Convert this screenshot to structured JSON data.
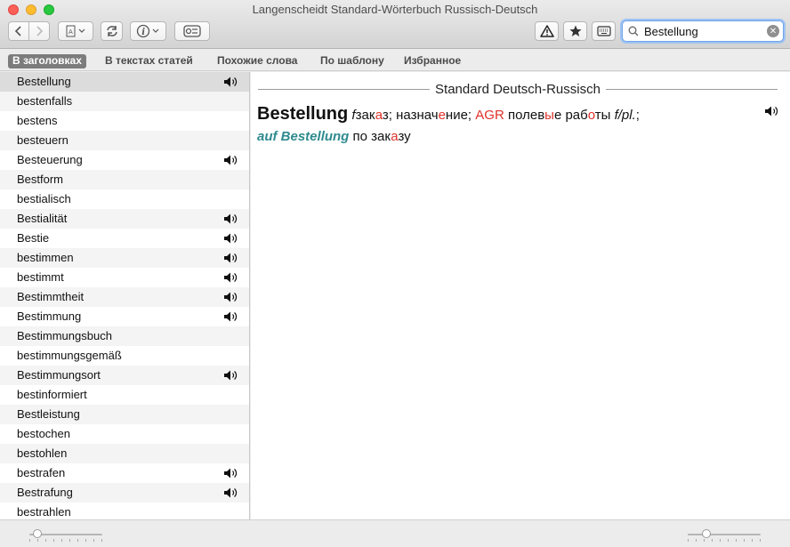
{
  "window": {
    "title": "Langenscheidt Standard-Wörterbuch Russisch-Deutsch"
  },
  "toolbar": {
    "back_icon": "chevron-left-icon",
    "forward_icon": "chevron-right-icon",
    "dictionary_menu_icon": "book-icon",
    "sync_icon": "sync-icon",
    "info_icon": "info-icon",
    "flashcards_icon": "flashcard-icon",
    "warning_icon": "warning-icon",
    "favorites_icon": "star-icon",
    "keyboard_icon": "keyboard-icon"
  },
  "search": {
    "value": "Bestellung",
    "placeholder": ""
  },
  "tabs": [
    {
      "label": "В заголовках",
      "active": true
    },
    {
      "label": "В текстах статей",
      "active": false
    },
    {
      "label": "Похожие слова",
      "active": false
    },
    {
      "label": "По шаблону",
      "active": false
    },
    {
      "label": "Избранное",
      "active": false
    }
  ],
  "word_list": [
    {
      "word": "Bestellung",
      "audio": true,
      "selected": true
    },
    {
      "word": "bestenfalls",
      "audio": false
    },
    {
      "word": "bestens",
      "audio": false
    },
    {
      "word": "besteuern",
      "audio": false
    },
    {
      "word": "Besteuerung",
      "audio": true
    },
    {
      "word": "Bestform",
      "audio": false
    },
    {
      "word": "bestialisch",
      "audio": false
    },
    {
      "word": "Bestialität",
      "audio": true
    },
    {
      "word": "Bestie",
      "audio": true
    },
    {
      "word": "bestimmen",
      "audio": true
    },
    {
      "word": "bestimmt",
      "audio": true
    },
    {
      "word": "Bestimmtheit",
      "audio": true
    },
    {
      "word": "Bestimmung",
      "audio": true
    },
    {
      "word": "Bestimmungsbuch",
      "audio": false
    },
    {
      "word": "bestimmungsgemäß",
      "audio": false
    },
    {
      "word": "Bestimmungsort",
      "audio": true
    },
    {
      "word": "bestinformiert",
      "audio": false
    },
    {
      "word": "Bestleistung",
      "audio": false
    },
    {
      "word": "bestochen",
      "audio": false
    },
    {
      "word": "bestohlen",
      "audio": false
    },
    {
      "word": "bestrafen",
      "audio": true
    },
    {
      "word": "Bestrafung",
      "audio": true
    },
    {
      "word": "bestrahlen",
      "audio": false
    }
  ],
  "entry": {
    "dictionary_name": "Standard Deutsch-Russisch",
    "headword": "Bestellung",
    "gender": "f",
    "t1_a": "зак",
    "t1_stress": "а",
    "t1_b": "з; назнач",
    "t1_stress2": "е",
    "t1_c": "ние;",
    "domain": "AGR",
    "t2_a": "полев",
    "t2_stress": "ы",
    "t2_b": "е раб",
    "t2_stress2": "о",
    "t2_c": "ты",
    "plural_note": "f/pl.",
    "semicolon": ";",
    "phrase": "auf Bestellung",
    "phrase_a": "по зак",
    "phrase_stress": "а",
    "phrase_b": "зу"
  },
  "colors": {
    "stress": "#e0322a",
    "phrase": "#2e8b8f",
    "selected_tab": "#7c7c7c"
  }
}
